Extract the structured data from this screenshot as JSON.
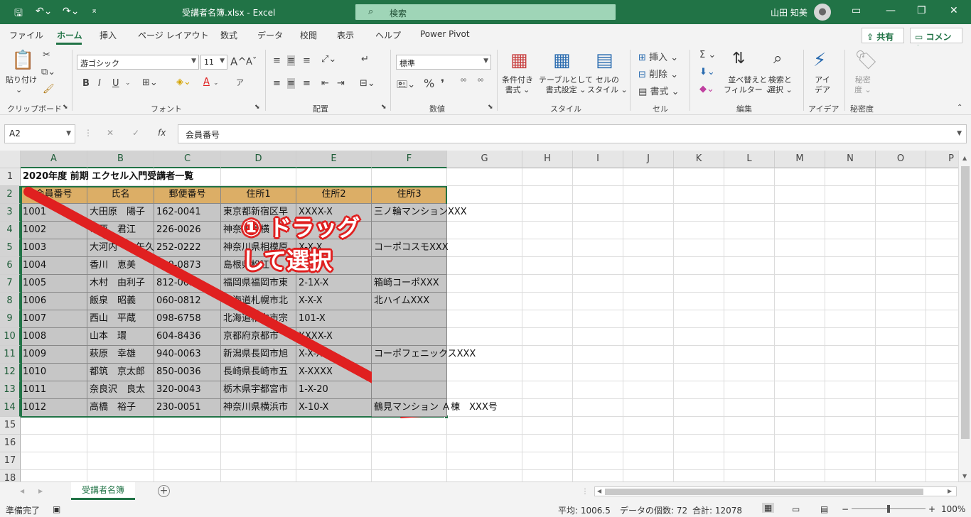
{
  "titlebar": {
    "title": "受講者名簿.xlsx  -  Excel",
    "search_placeholder": "検索",
    "user": "山田 知美",
    "quick_access": [
      "save-icon",
      "undo-icon",
      "redo-icon",
      "customize-icon"
    ]
  },
  "tabs": [
    "ファイル",
    "ホーム",
    "挿入",
    "ページ レイアウト",
    "数式",
    "データ",
    "校閲",
    "表示",
    "ヘルプ",
    "Power Pivot"
  ],
  "active_tab": "ホーム",
  "share_label": "共有",
  "comment_label": "コメント",
  "ribbon": {
    "clipboard": {
      "paste": "貼り付け",
      "group": "クリップボード"
    },
    "font": {
      "name": "游ゴシック",
      "size": "11",
      "bold": "B",
      "italic": "I",
      "underline": "U",
      "group": "フォント",
      "grow": "A",
      "shrink": "A",
      "phonetic": "ア",
      "font_color": "A"
    },
    "alignment": {
      "group": "配置"
    },
    "number": {
      "format": "標準",
      "group": "数値",
      "percent": "%"
    },
    "styles": {
      "conditional": [
        "条件付き",
        "書式"
      ],
      "table": [
        "テーブルとして",
        "書式設定"
      ],
      "cell": [
        "セルの",
        "スタイル"
      ],
      "group": "スタイル"
    },
    "cells": {
      "insert": "挿入",
      "delete": "削除",
      "format": "書式",
      "group": "セル"
    },
    "editing": {
      "sort": [
        "並べ替えと",
        "フィルター"
      ],
      "find": [
        "検索と",
        "選択"
      ],
      "group": "編集"
    },
    "ideas": {
      "label": [
        "アイ",
        "デア"
      ],
      "group": "アイデア"
    },
    "sensitivity": {
      "label": [
        "秘密",
        "度"
      ],
      "group": "秘密度"
    }
  },
  "formula_bar": {
    "name_box": "A2",
    "content": "会員番号",
    "cancel": "✕",
    "enter": "✓",
    "fx": "fx"
  },
  "columns": [
    "A",
    "B",
    "C",
    "D",
    "E",
    "F",
    "G",
    "H",
    "I",
    "J",
    "K",
    "L",
    "M",
    "N",
    "O",
    "P"
  ],
  "rows": [
    "1",
    "2",
    "3",
    "4",
    "5",
    "6",
    "7",
    "8",
    "9",
    "10",
    "11",
    "12",
    "13",
    "14",
    "15",
    "16",
    "17",
    "18"
  ],
  "sheet": {
    "title": "2020年度 前期 エクセル入門受講者一覧",
    "headers": [
      "会員番号",
      "氏名",
      "郵便番号",
      "住所1",
      "住所2",
      "住所3"
    ],
    "data": [
      [
        "1001",
        "大田原　陽子",
        "162-0041",
        "東京都新宿区早",
        "XXXX-X",
        "三ノ輪マンションXXX"
      ],
      [
        "1002",
        "市原　君江",
        "226-0026",
        "神奈川県横",
        "",
        ""
      ],
      [
        "1003",
        "大河内　一矢久",
        "252-0222",
        "神奈川県相模原",
        "X-X-X",
        "コーポコスモXXX"
      ],
      [
        "1004",
        "香川　恵美",
        "690-0873",
        "島根県松江",
        "",
        ""
      ],
      [
        "1005",
        "木村　由利子",
        "812-0053",
        "福岡県福岡市東",
        "2-1X-X",
        "箱崎コーポXXX"
      ],
      [
        "1006",
        "飯泉　昭義",
        "060-0812",
        "北海道札幌市北",
        "X-X-X",
        "北ハイムXXX"
      ],
      [
        "1007",
        "西山　平蔵",
        "098-6758",
        "北海道稚内市宗",
        "101-X",
        ""
      ],
      [
        "1008",
        "山本　環",
        "604-8436",
        "京都府京都市",
        "XXXX-X",
        ""
      ],
      [
        "1009",
        "萩原　幸雄",
        "940-0063",
        "新潟県長岡市旭",
        "X-X-X",
        "コーポフェニックスXXX"
      ],
      [
        "1010",
        "都筑　京太郎",
        "850-0036",
        "長崎県長崎市五",
        "X-XXXX",
        ""
      ],
      [
        "1011",
        "奈良沢　良太",
        "320-0043",
        "栃木県宇都宮市",
        "1-X-20",
        ""
      ],
      [
        "1012",
        "高橋　裕子",
        "230-0051",
        "神奈川県横浜市",
        "X-10-X",
        "鶴見マンション Ａ棟　XXX号"
      ]
    ]
  },
  "annotation": [
    "① ドラッグ",
    "して選択"
  ],
  "sheet_tab": "受講者名簿",
  "status": {
    "ready": "準備完了",
    "average": "平均: 1006.5",
    "count": "データの個数: 72",
    "sum": "合計: 12078",
    "zoom": "100%"
  },
  "colors": {
    "excel_green": "#217346",
    "header_fill": "#dcae66",
    "selection": "#c6c6c6",
    "annotation_red": "#e02020"
  }
}
